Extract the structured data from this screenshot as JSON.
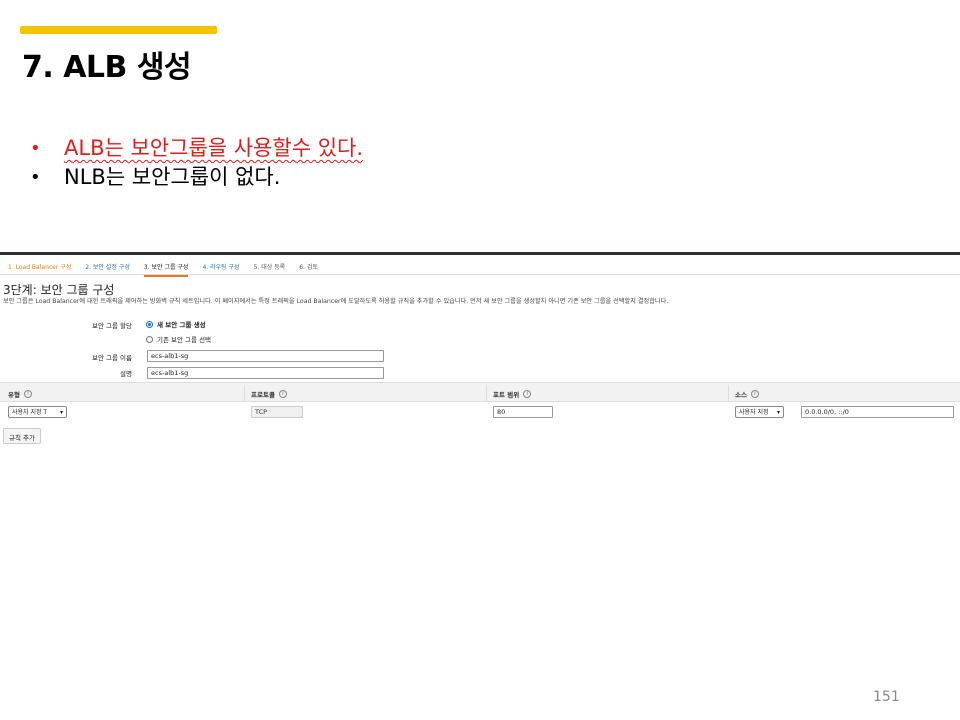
{
  "slide": {
    "title": "7. ALB 생성",
    "bullets": [
      {
        "marker": "•",
        "text": "ALB는 보안그룹을 사용할수 있다.",
        "color": "#e31b1b"
      },
      {
        "marker": "•",
        "text": "NLB는 보안그룹이 없다.",
        "color": "#000000"
      }
    ],
    "page_number": "151",
    "accent_color": "#f5c400"
  },
  "wizard": {
    "steps": [
      "1. Load Balancer 구성",
      "2. 보안 설정 구성",
      "3. 보안 그룹 구성",
      "4. 라우팅 구성",
      "5. 대상 등록",
      "6. 검토"
    ],
    "active_step_index": 2,
    "section_title": "3단계: 보안 그룹 구성",
    "section_desc": "보안 그룹은 Load Balancer에 대한 트래픽을 제어하는 방화벽 규칙 세트입니다. 이 페이지에서는 특정 트래픽을 Load Balancer에 도달하도록 허용할 규칙을 추가할 수 있습니다. 먼저 새 보안 그룹을 생성할지 아니면 기존 보안 그룹을 선택할지 결정합니다.",
    "assign_label": "보안 그룹 할당",
    "radio_new": "새 보안 그룹 생성",
    "radio_existing": "기존 보안 그룹 선택",
    "name_label": "보안 그룹 이름",
    "name_value": "ecs-alb1-sg",
    "desc_label": "설명",
    "desc_value": "ecs-alb1-sg",
    "table": {
      "headers": {
        "type": "유형",
        "protocol": "프로토콜",
        "port": "포트 범위",
        "source": "소스"
      },
      "row": {
        "type": "사용자 지정 T",
        "protocol": "TCP",
        "port": "80",
        "source_select": "사용자 지정",
        "source_value": "0.0.0.0/0, ::/0"
      }
    },
    "add_rule_label": "규칙 추가"
  }
}
